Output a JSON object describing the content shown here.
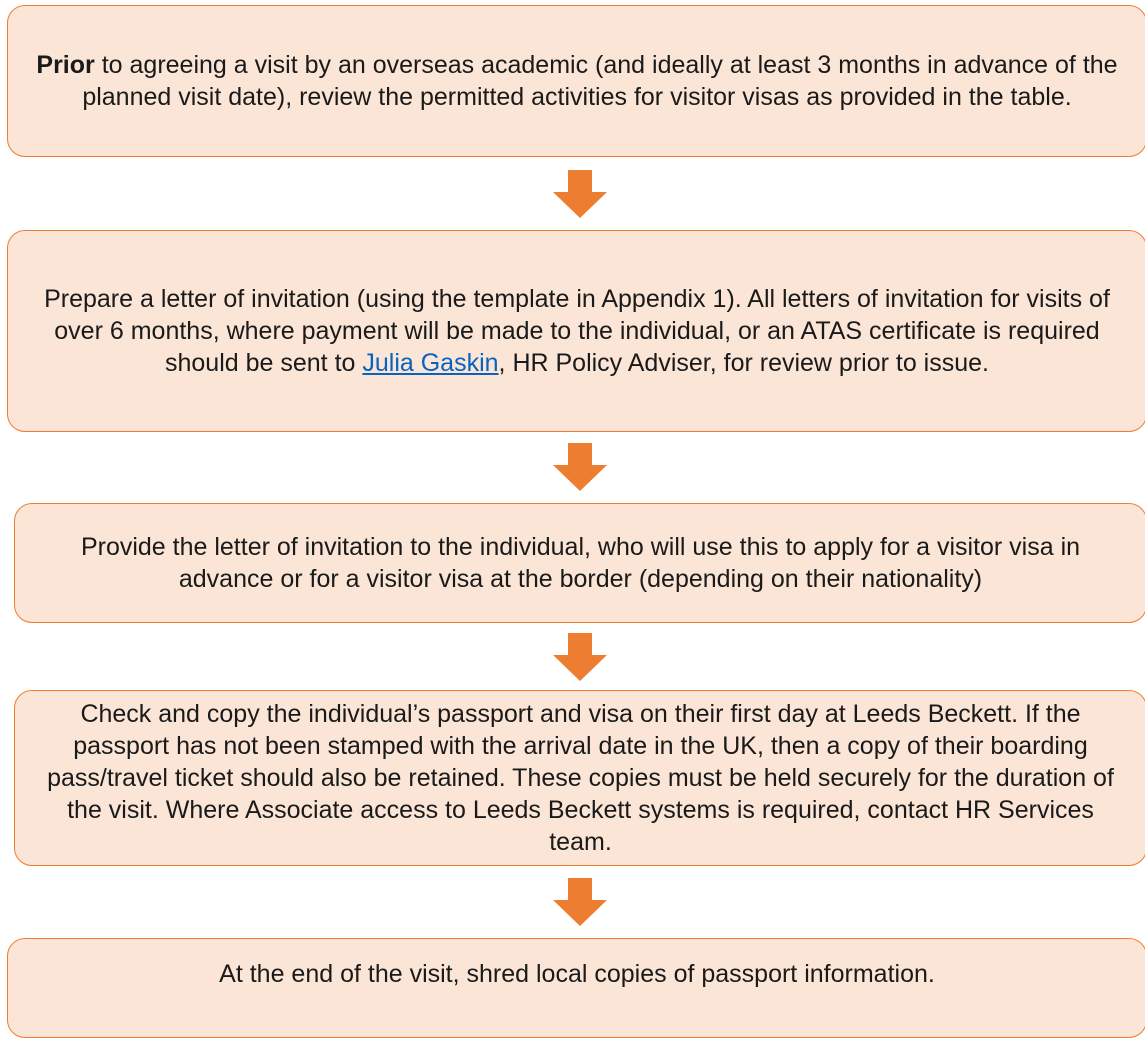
{
  "flow": {
    "step1": {
      "lead": "Prior",
      "text": " to agreeing a visit by an overseas academic (and ideally at least 3 months in advance of the planned visit date), review the permitted activities for visitor visas as provided in the table."
    },
    "step2": {
      "before_link": "Prepare a letter of invitation (using the template in Appendix 1).  All letters of invitation for visits of over 6 months, where payment will be made to the individual, or an ATAS certificate is required  should be sent to ",
      "link_text": "Julia Gaskin",
      "after_link": ", HR Policy Adviser, for review prior to issue."
    },
    "step3": {
      "text": "Provide the letter of invitation to the individual, who will use this to apply for a visitor visa in advance or for a visitor visa at the border (depending on their nationality)"
    },
    "step4": {
      "text": "Check and copy the individual’s passport and visa on their first day at Leeds Beckett. If the passport has not been stamped with the arrival date in the UK, then a copy of their boarding pass/travel ticket should also be retained.  These copies must be held securely for the duration of the visit.  Where Associate access to Leeds Beckett systems is required, contact HR Services team."
    },
    "step5": {
      "text": "At the end of the visit, shred local copies of passport information."
    }
  },
  "colors": {
    "box_fill": "#fbe5d6",
    "box_border": "#ed7d31",
    "arrow": "#ed7d31",
    "link": "#0563c1"
  }
}
